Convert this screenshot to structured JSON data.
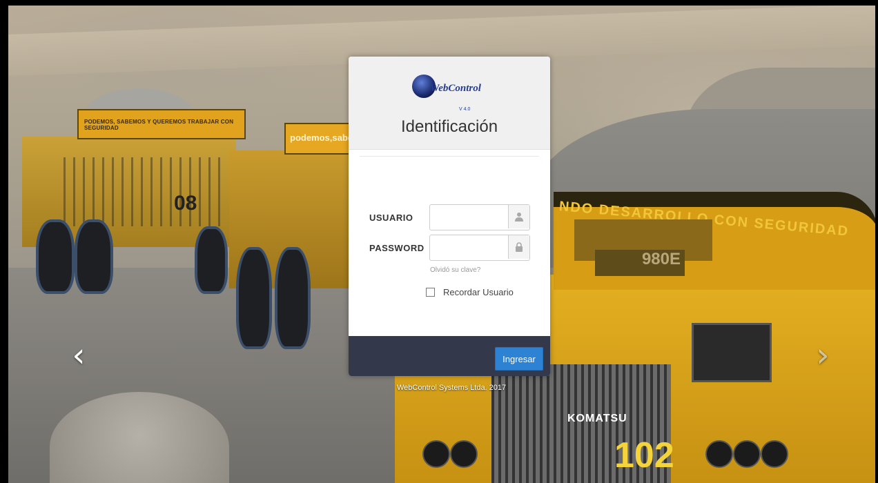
{
  "background": {
    "truck1_bed_text": "PODEMOS, SABEMOS Y QUEREMOS TRABAJAR CON SEGURIDAD",
    "truck1_number": "08",
    "truck2_bed_text": "podemos,sabemos",
    "truck3_slogan": "NDO DESARROLLO CON SEGURIDAD",
    "truck3_model": "980E",
    "truck3_brand": "KOMATSU",
    "truck3_number": "102"
  },
  "carousel": {
    "prev_icon": "chevron-left-icon",
    "next_icon": "chevron-right-icon"
  },
  "login": {
    "logo_text": "WebControl",
    "logo_version": "V 4.0",
    "title": "Identificación",
    "username_label": "USUARIO",
    "username_value": "",
    "username_icon": "user-icon",
    "password_label": "PASSWORD",
    "password_value": "",
    "password_icon": "lock-icon",
    "forgot_link": "Olvidó su clave?",
    "remember_label": "Recordar Usuario",
    "remember_checked": false,
    "submit_label": "Ingresar"
  },
  "footer": {
    "copyright": "WebControl Systems Ltda. 2017"
  },
  "colors": {
    "accent": "#2d82d4",
    "footer_bar": "#33394a"
  }
}
